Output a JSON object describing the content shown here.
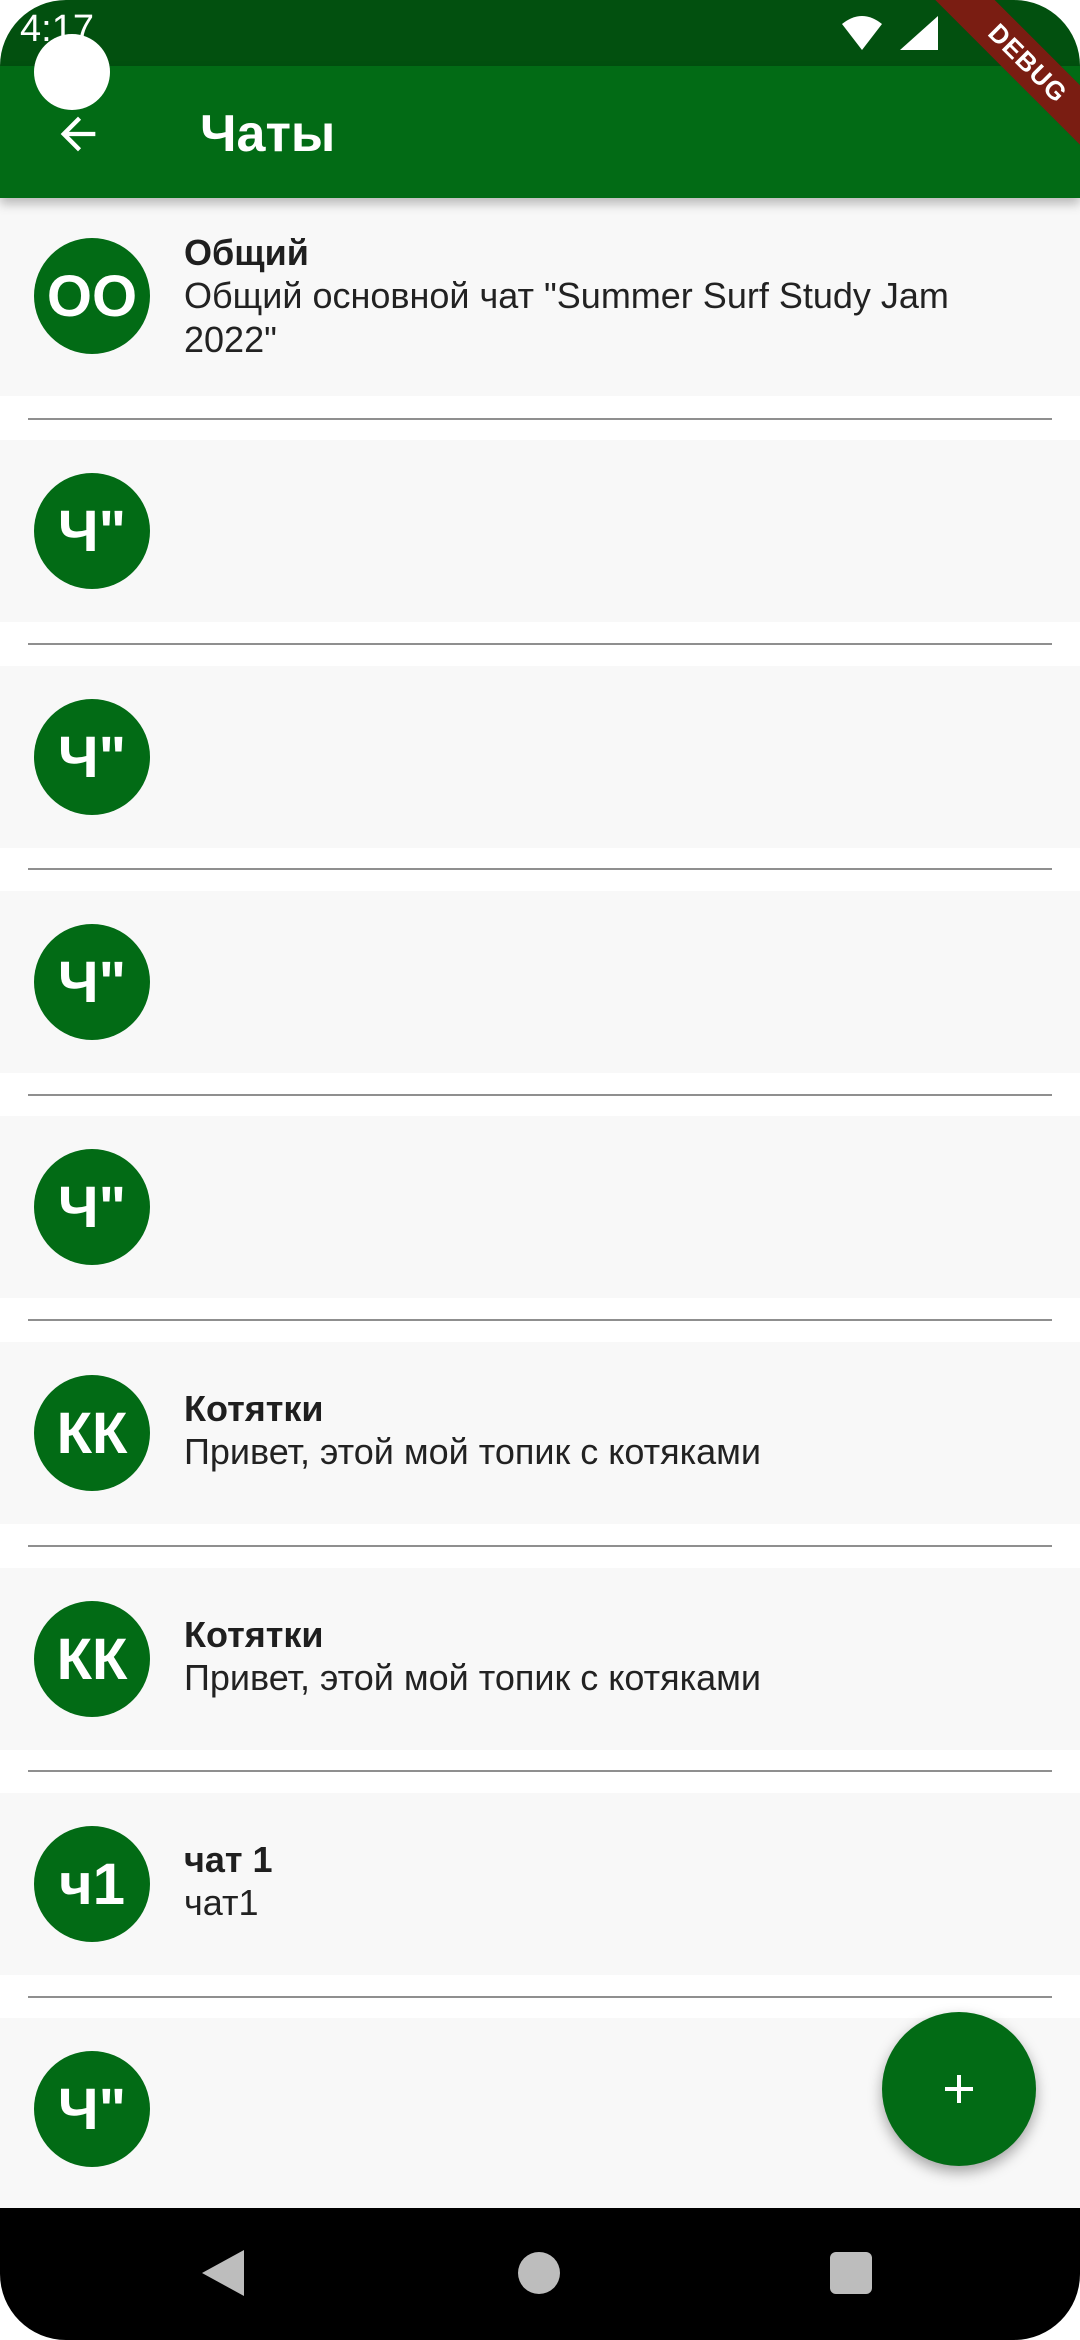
{
  "status_bar": {
    "time": "4:17"
  },
  "app_bar": {
    "title": "Чаты",
    "debug_label": "DEBUG"
  },
  "chats": [
    {
      "initials": "ОО",
      "name": "Общий",
      "subtitle": "Общий основной чат \"Summer Surf Study Jam 2022\""
    },
    {
      "initials": "Ч\"",
      "name": "",
      "subtitle": ""
    },
    {
      "initials": "Ч\"",
      "name": "",
      "subtitle": ""
    },
    {
      "initials": "Ч\"",
      "name": "",
      "subtitle": ""
    },
    {
      "initials": "Ч\"",
      "name": "",
      "subtitle": ""
    },
    {
      "initials": "КК",
      "name": "Котятки",
      "subtitle": "Привет, этой мой топик с котяками"
    },
    {
      "initials": "КК",
      "name": "Котятки",
      "subtitle": "Привет, этой мой топик с котяками"
    },
    {
      "initials": "ч1",
      "name": "чат 1",
      "subtitle": "чат1"
    },
    {
      "initials": "Ч\"",
      "name": "",
      "subtitle": ""
    }
  ],
  "icons": {
    "back": "arrow-back-icon",
    "fab": "plus-icon",
    "nav_back": "triangle-back-icon",
    "nav_home": "circle-home-icon",
    "nav_recent": "square-recents-icon"
  },
  "colors": {
    "app_bar": "#026b15",
    "status_bar": "#02500f",
    "avatar": "#026b15",
    "item_background": "#f8f8f8",
    "divider": "#8f8f8f",
    "debug_ribbon": "#7a1d12"
  }
}
